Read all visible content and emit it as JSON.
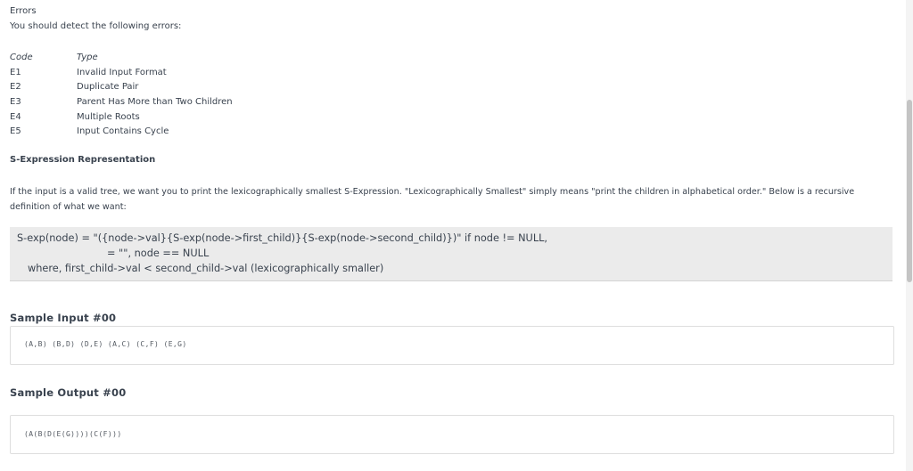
{
  "errors_section": {
    "heading": "Errors",
    "intro": "You should detect the following errors:",
    "columns": {
      "code": "Code",
      "type": "Type"
    },
    "rows": [
      {
        "code": "E1",
        "type": "Invalid Input Format"
      },
      {
        "code": "E2",
        "type": "Duplicate Pair"
      },
      {
        "code": "E3",
        "type": "Parent Has More than Two Children"
      },
      {
        "code": "E4",
        "type": "Multiple Roots"
      },
      {
        "code": "E5",
        "type": "Input Contains Cycle"
      }
    ]
  },
  "sexp_section": {
    "heading": "S-Expression Representation",
    "description": "If the input is a valid tree, we want you to print the lexicographically smallest S-Expression. \"Lexicographically Smallest\" simply means \"print the children in alphabetical order.\" Below is a recursive definition of what we want:",
    "code_lines": [
      "S-exp(node) = \"({node->val}{S-exp(node->first_child)}{S-exp(node->second_child)})\" if node != NULL,",
      "= \"\", node == NULL",
      "where, first_child->val < second_child->val (lexicographically smaller)"
    ]
  },
  "sample_input": {
    "heading": "Sample Input #00",
    "value": "(A,B) (B,D) (D,E) (A,C) (C,F) (E,G)"
  },
  "sample_output": {
    "heading": "Sample Output #00",
    "value": "(A(B(D(E(G))))(C(F)))"
  }
}
